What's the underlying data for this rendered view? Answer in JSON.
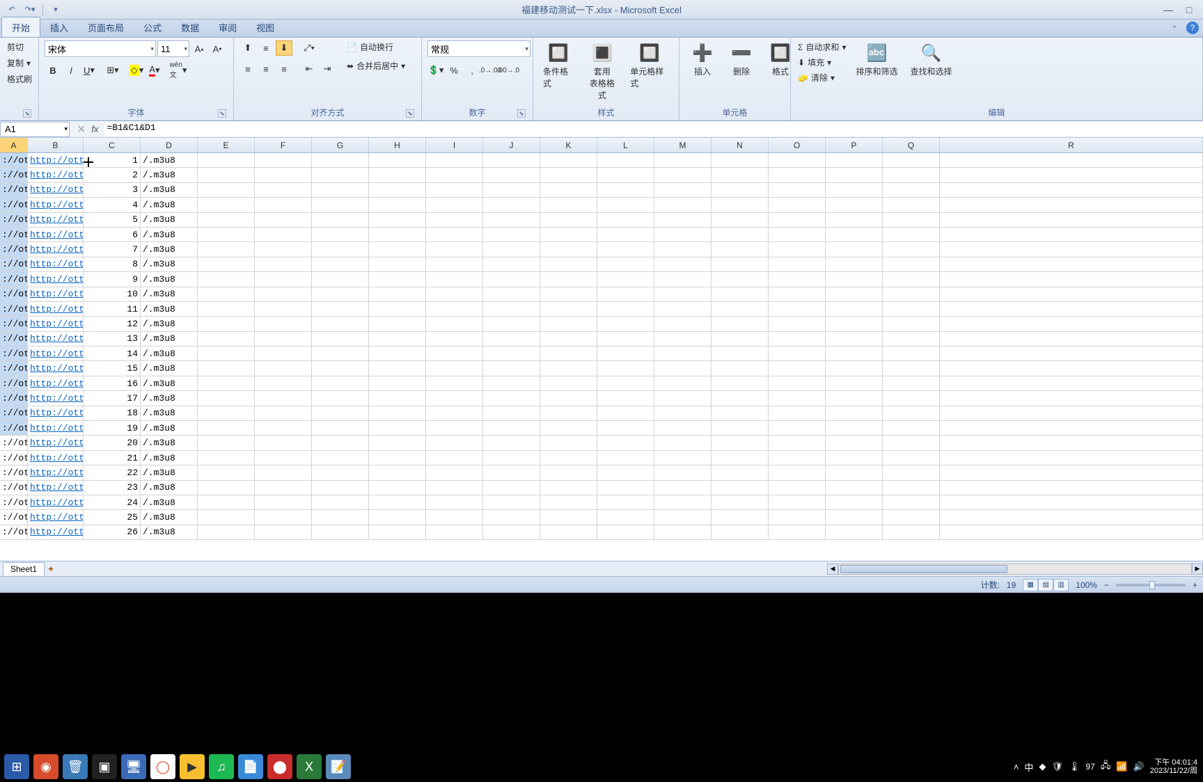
{
  "title": "福建移动测试一下.xlsx - Microsoft Excel",
  "tabs": [
    "开始",
    "插入",
    "页面布局",
    "公式",
    "数据",
    "审阅",
    "视图"
  ],
  "clipboard": {
    "cut": "剪切",
    "copy": "复制",
    "paint": "格式刷"
  },
  "font": {
    "name": "宋体",
    "size": "11"
  },
  "group_labels": {
    "font": "字体",
    "align": "对齐方式",
    "number": "数字",
    "styles": "样式",
    "cells": "单元格",
    "editing": "编辑"
  },
  "align": {
    "wrap": "自动换行",
    "merge": "合并后居中"
  },
  "number_format": "常规",
  "styles": {
    "cond": "条件格式",
    "table": "套用\n表格格式",
    "cell": "单元格样式"
  },
  "cells": {
    "insert": "插入",
    "delete": "删除",
    "format": "格式"
  },
  "editing": {
    "sum": "自动求和",
    "fill": "填充",
    "clear": "清除",
    "sort": "排序和筛选",
    "find": "查找和选择"
  },
  "name_box": "A1",
  "formula": "=B1&C1&D1",
  "columns": [
    "A",
    "B",
    "C",
    "D",
    "E",
    "F",
    "G",
    "H",
    "I",
    "J",
    "K",
    "L",
    "M",
    "N",
    "O",
    "P",
    "Q",
    "R"
  ],
  "rows": [
    {
      "a": "://ot",
      "b": "http://ott.f",
      "c": "1",
      "d": "/.m3u8"
    },
    {
      "a": "://ot",
      "b": "http://ott.f",
      "c": "2",
      "d": "/.m3u8"
    },
    {
      "a": "://ot",
      "b": "http://ott.f",
      "c": "3",
      "d": "/.m3u8"
    },
    {
      "a": "://ot",
      "b": "http://ott.f",
      "c": "4",
      "d": "/.m3u8"
    },
    {
      "a": "://ot",
      "b": "http://ott.f",
      "c": "5",
      "d": "/.m3u8"
    },
    {
      "a": "://ot",
      "b": "http://ott.f",
      "c": "6",
      "d": "/.m3u8"
    },
    {
      "a": "://ot",
      "b": "http://ott.f",
      "c": "7",
      "d": "/.m3u8"
    },
    {
      "a": "://ot",
      "b": "http://ott.f",
      "c": "8",
      "d": "/.m3u8"
    },
    {
      "a": "://ot",
      "b": "http://ott.f",
      "c": "9",
      "d": "/.m3u8"
    },
    {
      "a": "://ot",
      "b": "http://ott.f",
      "c": "10",
      "d": "/.m3u8"
    },
    {
      "a": "://ot",
      "b": "http://ott.f",
      "c": "11",
      "d": "/.m3u8"
    },
    {
      "a": "://ot",
      "b": "http://ott.f",
      "c": "12",
      "d": "/.m3u8"
    },
    {
      "a": "://ot",
      "b": "http://ott.f",
      "c": "13",
      "d": "/.m3u8"
    },
    {
      "a": "://ot",
      "b": "http://ott.f",
      "c": "14",
      "d": "/.m3u8"
    },
    {
      "a": "://ot",
      "b": "http://ott.f",
      "c": "15",
      "d": "/.m3u8"
    },
    {
      "a": "://ot",
      "b": "http://ott.f",
      "c": "16",
      "d": "/.m3u8"
    },
    {
      "a": "://ot",
      "b": "http://ott.f",
      "c": "17",
      "d": "/.m3u8"
    },
    {
      "a": "://ot",
      "b": "http://ott.f",
      "c": "18",
      "d": "/.m3u8"
    },
    {
      "a": "://ot",
      "b": "http://ott.f",
      "c": "19",
      "d": "/.m3u8"
    },
    {
      "a": "://ot",
      "b": "http://ott.f",
      "c": "20",
      "d": "/.m3u8"
    },
    {
      "a": "://ot",
      "b": "http://ott.f",
      "c": "21",
      "d": "/.m3u8"
    },
    {
      "a": "://ot",
      "b": "http://ott.f",
      "c": "22",
      "d": "/.m3u8"
    },
    {
      "a": "://ot",
      "b": "http://ott.f",
      "c": "23",
      "d": "/.m3u8"
    },
    {
      "a": "://ot",
      "b": "http://ott.f",
      "c": "24",
      "d": "/.m3u8"
    },
    {
      "a": "://ot",
      "b": "http://ott.f",
      "c": "25",
      "d": "/.m3u8"
    },
    {
      "a": "://ot",
      "b": "http://ott.f",
      "c": "26",
      "d": "/.m3u8"
    }
  ],
  "selected_rows": 19,
  "sheet": "Sheet1",
  "status": {
    "count_label": "计数:",
    "count": "19",
    "zoom": "100%"
  },
  "tray": {
    "temp": "97",
    "time": "下午 04:01:4",
    "date": "2023/11/22/周"
  }
}
